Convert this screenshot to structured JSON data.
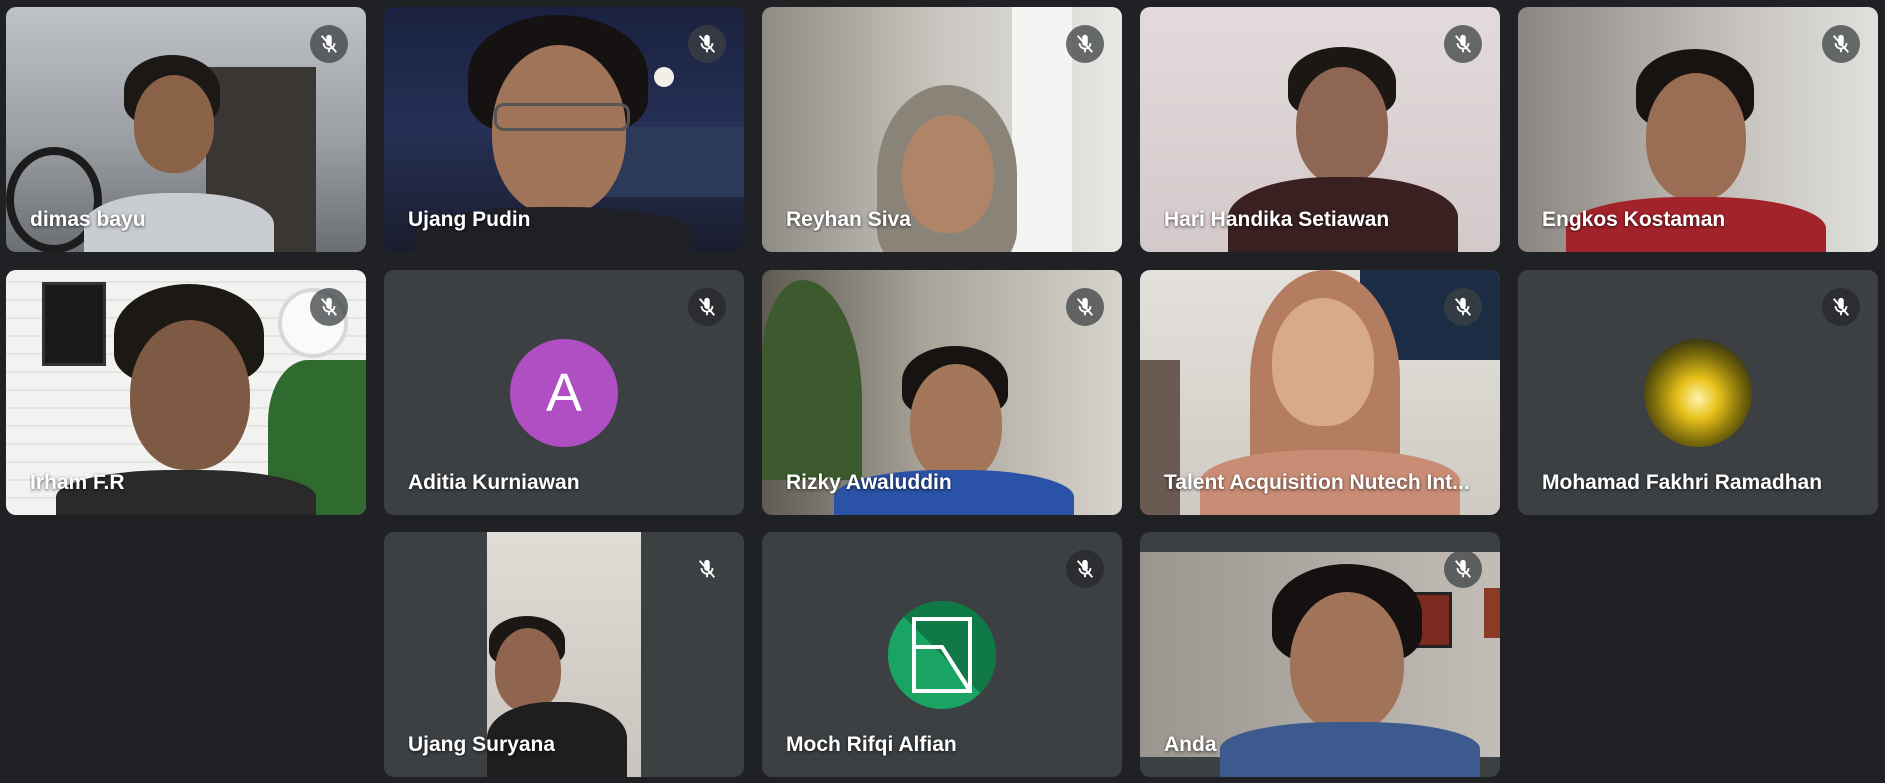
{
  "participants": [
    {
      "name": "dimas bayu",
      "muted": true
    },
    {
      "name": "Ujang Pudin",
      "muted": true
    },
    {
      "name": "Reyhan Siva",
      "muted": true
    },
    {
      "name": "Hari Handika Setiawan",
      "muted": true
    },
    {
      "name": "Engkos Kostaman",
      "muted": true
    },
    {
      "name": "Irham F.R",
      "muted": true
    },
    {
      "name": "Aditia Kurniawan",
      "muted": true,
      "avatar_letter": "A",
      "avatar_color": "#b04fc4"
    },
    {
      "name": "Rizky Awaluddin",
      "muted": true
    },
    {
      "name": "Talent Acquisition Nutech Int...",
      "muted": true
    },
    {
      "name": "Mohamad Fakhri Ramadhan",
      "muted": true
    },
    {
      "name": "Ujang Suryana",
      "muted": true
    },
    {
      "name": "Moch Rifqi Alfian",
      "muted": true,
      "avatar_color": "#0f9d58"
    },
    {
      "name": "Anda",
      "muted": true
    }
  ],
  "icons": {
    "mic": "mic-off-icon"
  },
  "colors": {
    "background": "#202124",
    "tile": "#3c4043"
  }
}
